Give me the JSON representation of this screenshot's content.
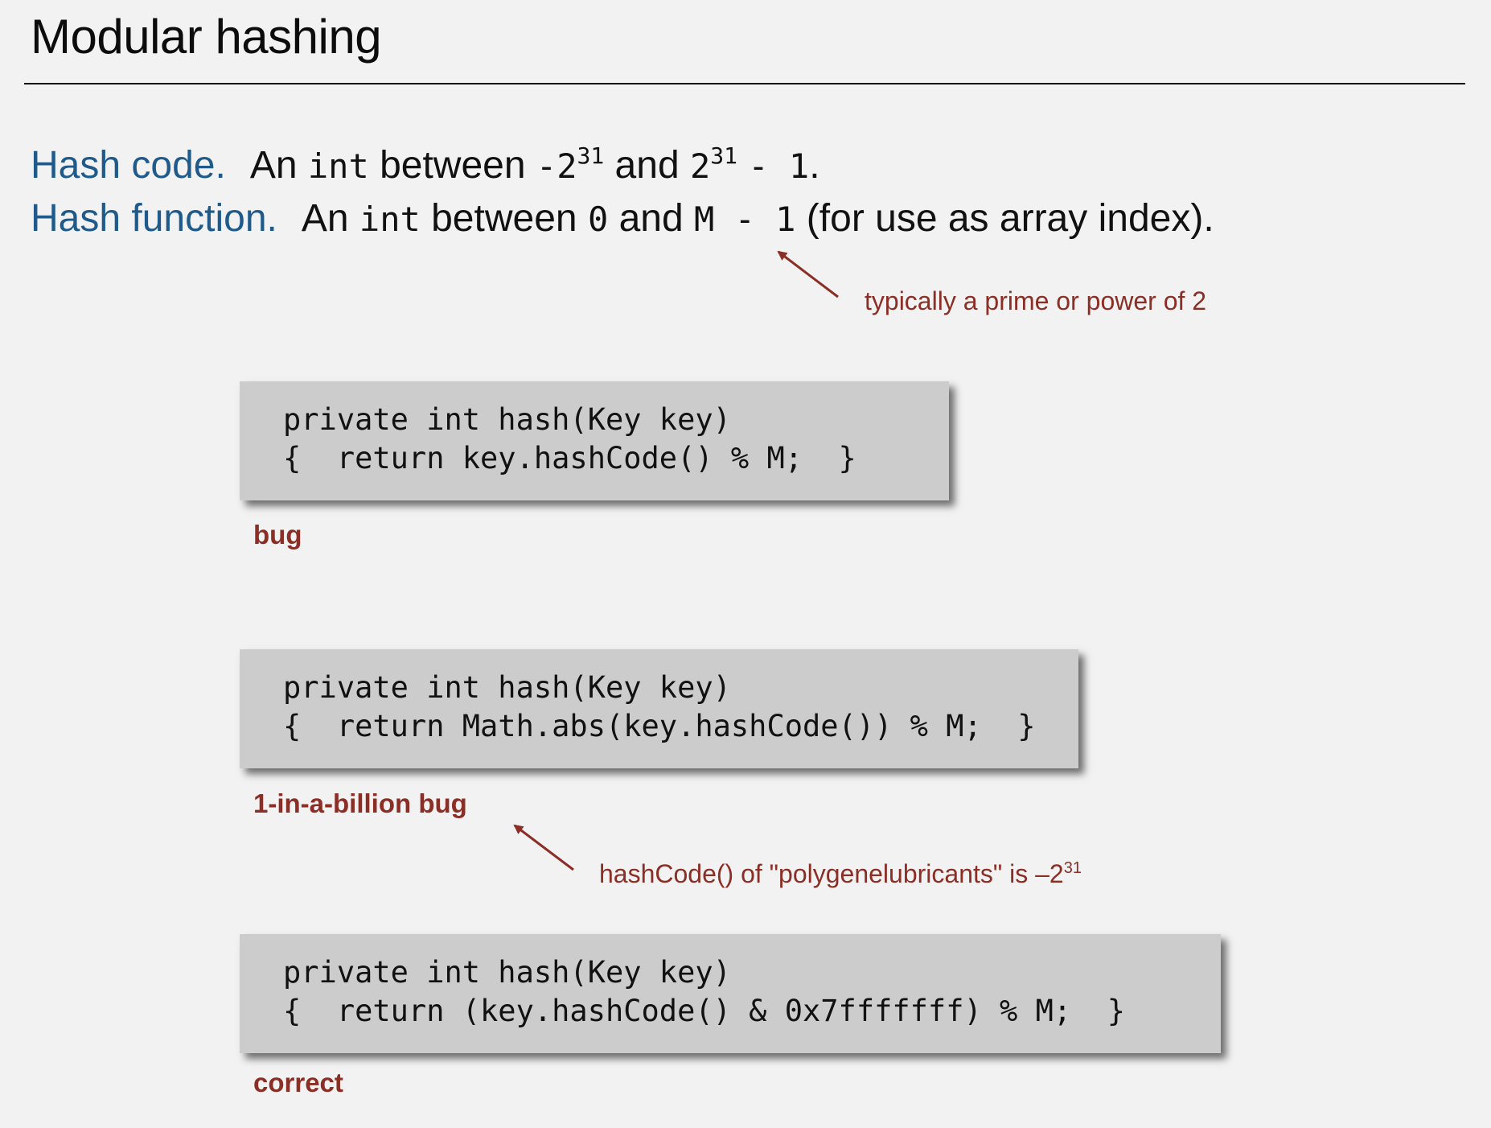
{
  "slide": {
    "title": "Modular hashing"
  },
  "definitions": {
    "hash_code": {
      "term": "Hash code.",
      "an": "An",
      "int": "int",
      "between": "between",
      "neg": "-2",
      "exp1": "31",
      "and": "and",
      "two": "2",
      "exp2": "31",
      "minus_one": "- 1",
      "period": "."
    },
    "hash_function": {
      "term": "Hash function.",
      "an": "An",
      "int": "int",
      "between": "between",
      "zero": "0",
      "and": "and",
      "m_minus_one": "M - 1",
      "rest": "(for use as array index)."
    }
  },
  "annotations": {
    "prime_note": "typically a prime or power of 2",
    "polygene_note": {
      "text": "hashCode() of \"polygenelubricants\" is –2",
      "exp": "31"
    }
  },
  "code_examples": [
    {
      "line1": "private int hash(Key key)",
      "line2": "{  return key.hashCode() % M;  }",
      "label": "bug"
    },
    {
      "line1": "private int hash(Key key)",
      "line2": "{  return Math.abs(key.hashCode()) % M;  }",
      "label": "1-in-a-billion bug"
    },
    {
      "line1": "private int hash(Key key)",
      "line2": "{  return (key.hashCode() & 0x7fffffff) % M;  }",
      "label": "correct"
    }
  ],
  "colors": {
    "term": "#1f5a8b",
    "annotation": "#8b2e26",
    "code_box": "#cccccc",
    "background": "#f2f2f2"
  }
}
